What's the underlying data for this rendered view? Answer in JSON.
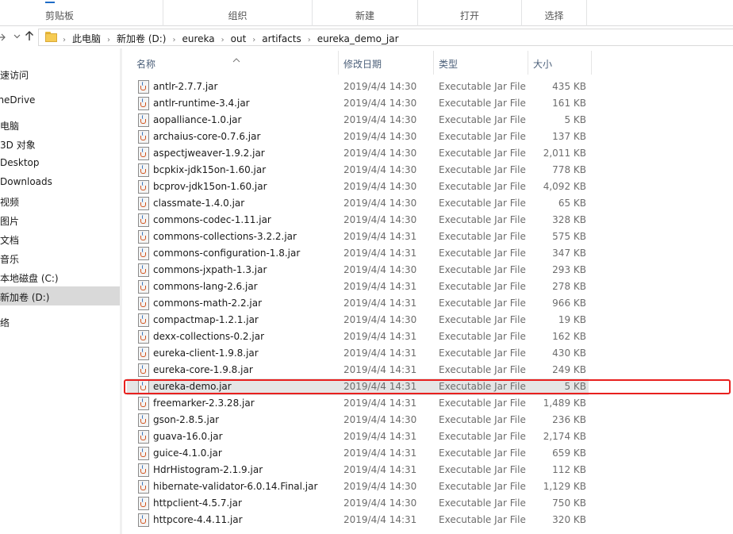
{
  "ribbon": {
    "groups": [
      "剪贴板",
      "组织",
      "新建",
      "打开",
      "选择"
    ]
  },
  "nav": {
    "back_icon": "arrow-left-icon",
    "forward_icon": "arrow-right-icon",
    "recent_icon": "chevron-down-icon",
    "up_icon": "arrow-up-icon",
    "up_glyph": "🡑",
    "breadcrumbs": [
      "此电脑",
      "新加卷 (D:)",
      "eureka",
      "out",
      "artifacts",
      "eureka_demo_jar"
    ],
    "separator": "›"
  },
  "sidebar": {
    "items": [
      {
        "label": "快速访问",
        "selected": false
      },
      {
        "label": "OneDrive",
        "selected": false
      },
      {
        "label": "此电脑",
        "selected": false
      },
      {
        "label": "3D 对象",
        "selected": false
      },
      {
        "label": "Desktop",
        "selected": false
      },
      {
        "label": "Downloads",
        "selected": false
      },
      {
        "label": "视频",
        "selected": false
      },
      {
        "label": "图片",
        "selected": false
      },
      {
        "label": "文档",
        "selected": false
      },
      {
        "label": "音乐",
        "selected": false
      },
      {
        "label": "本地磁盘 (C:)",
        "selected": false
      },
      {
        "label": "新加卷 (D:)",
        "selected": true
      },
      {
        "label": "网络",
        "selected": false
      }
    ]
  },
  "columns": {
    "name": "名称",
    "date": "修改日期",
    "type": "类型",
    "size": "大小"
  },
  "files": [
    {
      "name": "antlr-2.7.7.jar",
      "date": "2019/4/4 14:30",
      "type": "Executable Jar File",
      "size": "435 KB"
    },
    {
      "name": "antlr-runtime-3.4.jar",
      "date": "2019/4/4 14:30",
      "type": "Executable Jar File",
      "size": "161 KB"
    },
    {
      "name": "aopalliance-1.0.jar",
      "date": "2019/4/4 14:30",
      "type": "Executable Jar File",
      "size": "5 KB"
    },
    {
      "name": "archaius-core-0.7.6.jar",
      "date": "2019/4/4 14:30",
      "type": "Executable Jar File",
      "size": "137 KB"
    },
    {
      "name": "aspectjweaver-1.9.2.jar",
      "date": "2019/4/4 14:30",
      "type": "Executable Jar File",
      "size": "2,011 KB"
    },
    {
      "name": "bcpkix-jdk15on-1.60.jar",
      "date": "2019/4/4 14:30",
      "type": "Executable Jar File",
      "size": "778 KB"
    },
    {
      "name": "bcprov-jdk15on-1.60.jar",
      "date": "2019/4/4 14:30",
      "type": "Executable Jar File",
      "size": "4,092 KB"
    },
    {
      "name": "classmate-1.4.0.jar",
      "date": "2019/4/4 14:30",
      "type": "Executable Jar File",
      "size": "65 KB"
    },
    {
      "name": "commons-codec-1.11.jar",
      "date": "2019/4/4 14:30",
      "type": "Executable Jar File",
      "size": "328 KB"
    },
    {
      "name": "commons-collections-3.2.2.jar",
      "date": "2019/4/4 14:31",
      "type": "Executable Jar File",
      "size": "575 KB"
    },
    {
      "name": "commons-configuration-1.8.jar",
      "date": "2019/4/4 14:31",
      "type": "Executable Jar File",
      "size": "347 KB"
    },
    {
      "name": "commons-jxpath-1.3.jar",
      "date": "2019/4/4 14:30",
      "type": "Executable Jar File",
      "size": "293 KB"
    },
    {
      "name": "commons-lang-2.6.jar",
      "date": "2019/4/4 14:31",
      "type": "Executable Jar File",
      "size": "278 KB"
    },
    {
      "name": "commons-math-2.2.jar",
      "date": "2019/4/4 14:31",
      "type": "Executable Jar File",
      "size": "966 KB"
    },
    {
      "name": "compactmap-1.2.1.jar",
      "date": "2019/4/4 14:30",
      "type": "Executable Jar File",
      "size": "19 KB"
    },
    {
      "name": "dexx-collections-0.2.jar",
      "date": "2019/4/4 14:31",
      "type": "Executable Jar File",
      "size": "162 KB"
    },
    {
      "name": "eureka-client-1.9.8.jar",
      "date": "2019/4/4 14:31",
      "type": "Executable Jar File",
      "size": "430 KB"
    },
    {
      "name": "eureka-core-1.9.8.jar",
      "date": "2019/4/4 14:31",
      "type": "Executable Jar File",
      "size": "249 KB"
    },
    {
      "name": "eureka-demo.jar",
      "date": "2019/4/4 14:31",
      "type": "Executable Jar File",
      "size": "5 KB",
      "highlighted": true
    },
    {
      "name": "freemarker-2.3.28.jar",
      "date": "2019/4/4 14:31",
      "type": "Executable Jar File",
      "size": "1,489 KB"
    },
    {
      "name": "gson-2.8.5.jar",
      "date": "2019/4/4 14:30",
      "type": "Executable Jar File",
      "size": "236 KB"
    },
    {
      "name": "guava-16.0.jar",
      "date": "2019/4/4 14:31",
      "type": "Executable Jar File",
      "size": "2,174 KB"
    },
    {
      "name": "guice-4.1.0.jar",
      "date": "2019/4/4 14:31",
      "type": "Executable Jar File",
      "size": "659 KB"
    },
    {
      "name": "HdrHistogram-2.1.9.jar",
      "date": "2019/4/4 14:31",
      "type": "Executable Jar File",
      "size": "112 KB"
    },
    {
      "name": "hibernate-validator-6.0.14.Final.jar",
      "date": "2019/4/4 14:30",
      "type": "Executable Jar File",
      "size": "1,129 KB"
    },
    {
      "name": "httpclient-4.5.7.jar",
      "date": "2019/4/4 14:30",
      "type": "Executable Jar File",
      "size": "750 KB"
    },
    {
      "name": "httpcore-4.4.11.jar",
      "date": "2019/4/4 14:31",
      "type": "Executable Jar File",
      "size": "320 KB"
    }
  ],
  "icons": {
    "file": "java-jar-file-icon",
    "folder": "folder-icon",
    "sort": "sort-ascending-icon"
  },
  "colors": {
    "highlight_row": "#e5e5e5",
    "annotation_box": "#e8201e",
    "header_text": "#4c607a"
  }
}
